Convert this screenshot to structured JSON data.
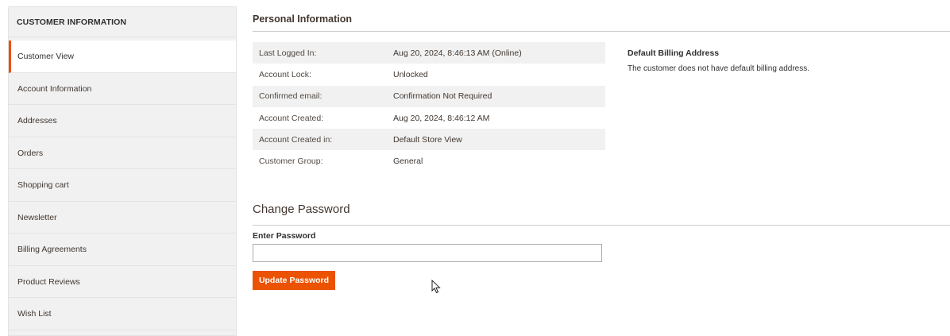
{
  "sidebar": {
    "title": "CUSTOMER INFORMATION",
    "items": [
      {
        "label": "Customer View",
        "active": true
      },
      {
        "label": "Account Information"
      },
      {
        "label": "Addresses"
      },
      {
        "label": "Orders"
      },
      {
        "label": "Shopping cart"
      },
      {
        "label": "Newsletter"
      },
      {
        "label": "Billing Agreements"
      },
      {
        "label": "Product Reviews"
      },
      {
        "label": "Wish List"
      }
    ]
  },
  "personal": {
    "title": "Personal Information",
    "rows": [
      {
        "label": "Last Logged In:",
        "value": "Aug 20, 2024, 8:46:13 AM (Online)"
      },
      {
        "label": "Account Lock:",
        "value": "Unlocked"
      },
      {
        "label": "Confirmed email:",
        "value": "Confirmation Not Required"
      },
      {
        "label": "Account Created:",
        "value": "Aug 20, 2024, 8:46:12 AM"
      },
      {
        "label": "Account Created in:",
        "value": "Default Store View"
      },
      {
        "label": "Customer Group:",
        "value": "General"
      }
    ]
  },
  "billing": {
    "title": "Default Billing Address",
    "text": "The customer does not have default billing address."
  },
  "change_password": {
    "title": "Change Password",
    "field_label": "Enter Password",
    "value": "",
    "button_label": "Update Password"
  },
  "colors": {
    "accent": "#eb5202",
    "sidebar_bg": "#f1f1f1"
  }
}
